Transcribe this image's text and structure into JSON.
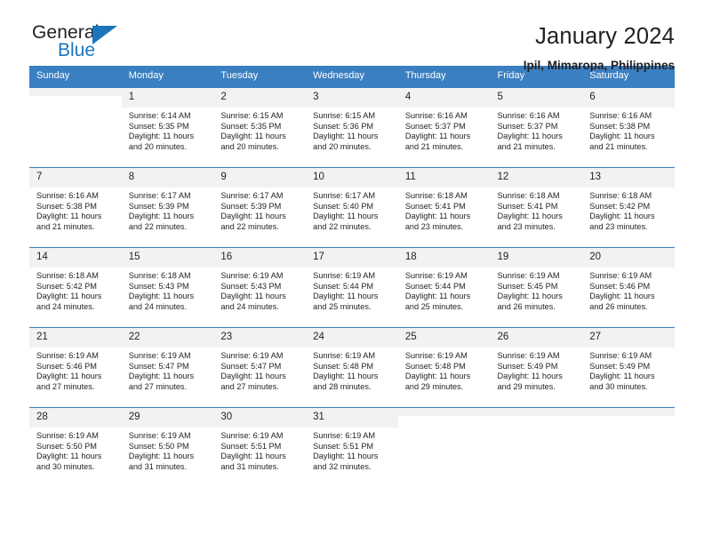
{
  "brand": {
    "name_part1": "General",
    "name_part2": "Blue",
    "triangle_color": "#1b75bb"
  },
  "header": {
    "title": "January 2024",
    "subtitle": "Ipil, Mimaropa, Philippines",
    "header_bg": "#3a7fc1"
  },
  "weekdays": [
    "Sunday",
    "Monday",
    "Tuesday",
    "Wednesday",
    "Thursday",
    "Friday",
    "Saturday"
  ],
  "weeks": [
    [
      {
        "day": "",
        "sunrise": "",
        "sunset": "",
        "daylight1": "",
        "daylight2": ""
      },
      {
        "day": "1",
        "sunrise": "Sunrise: 6:14 AM",
        "sunset": "Sunset: 5:35 PM",
        "daylight1": "Daylight: 11 hours",
        "daylight2": "and 20 minutes."
      },
      {
        "day": "2",
        "sunrise": "Sunrise: 6:15 AM",
        "sunset": "Sunset: 5:35 PM",
        "daylight1": "Daylight: 11 hours",
        "daylight2": "and 20 minutes."
      },
      {
        "day": "3",
        "sunrise": "Sunrise: 6:15 AM",
        "sunset": "Sunset: 5:36 PM",
        "daylight1": "Daylight: 11 hours",
        "daylight2": "and 20 minutes."
      },
      {
        "day": "4",
        "sunrise": "Sunrise: 6:16 AM",
        "sunset": "Sunset: 5:37 PM",
        "daylight1": "Daylight: 11 hours",
        "daylight2": "and 21 minutes."
      },
      {
        "day": "5",
        "sunrise": "Sunrise: 6:16 AM",
        "sunset": "Sunset: 5:37 PM",
        "daylight1": "Daylight: 11 hours",
        "daylight2": "and 21 minutes."
      },
      {
        "day": "6",
        "sunrise": "Sunrise: 6:16 AM",
        "sunset": "Sunset: 5:38 PM",
        "daylight1": "Daylight: 11 hours",
        "daylight2": "and 21 minutes."
      }
    ],
    [
      {
        "day": "7",
        "sunrise": "Sunrise: 6:16 AM",
        "sunset": "Sunset: 5:38 PM",
        "daylight1": "Daylight: 11 hours",
        "daylight2": "and 21 minutes."
      },
      {
        "day": "8",
        "sunrise": "Sunrise: 6:17 AM",
        "sunset": "Sunset: 5:39 PM",
        "daylight1": "Daylight: 11 hours",
        "daylight2": "and 22 minutes."
      },
      {
        "day": "9",
        "sunrise": "Sunrise: 6:17 AM",
        "sunset": "Sunset: 5:39 PM",
        "daylight1": "Daylight: 11 hours",
        "daylight2": "and 22 minutes."
      },
      {
        "day": "10",
        "sunrise": "Sunrise: 6:17 AM",
        "sunset": "Sunset: 5:40 PM",
        "daylight1": "Daylight: 11 hours",
        "daylight2": "and 22 minutes."
      },
      {
        "day": "11",
        "sunrise": "Sunrise: 6:18 AM",
        "sunset": "Sunset: 5:41 PM",
        "daylight1": "Daylight: 11 hours",
        "daylight2": "and 23 minutes."
      },
      {
        "day": "12",
        "sunrise": "Sunrise: 6:18 AM",
        "sunset": "Sunset: 5:41 PM",
        "daylight1": "Daylight: 11 hours",
        "daylight2": "and 23 minutes."
      },
      {
        "day": "13",
        "sunrise": "Sunrise: 6:18 AM",
        "sunset": "Sunset: 5:42 PM",
        "daylight1": "Daylight: 11 hours",
        "daylight2": "and 23 minutes."
      }
    ],
    [
      {
        "day": "14",
        "sunrise": "Sunrise: 6:18 AM",
        "sunset": "Sunset: 5:42 PM",
        "daylight1": "Daylight: 11 hours",
        "daylight2": "and 24 minutes."
      },
      {
        "day": "15",
        "sunrise": "Sunrise: 6:18 AM",
        "sunset": "Sunset: 5:43 PM",
        "daylight1": "Daylight: 11 hours",
        "daylight2": "and 24 minutes."
      },
      {
        "day": "16",
        "sunrise": "Sunrise: 6:19 AM",
        "sunset": "Sunset: 5:43 PM",
        "daylight1": "Daylight: 11 hours",
        "daylight2": "and 24 minutes."
      },
      {
        "day": "17",
        "sunrise": "Sunrise: 6:19 AM",
        "sunset": "Sunset: 5:44 PM",
        "daylight1": "Daylight: 11 hours",
        "daylight2": "and 25 minutes."
      },
      {
        "day": "18",
        "sunrise": "Sunrise: 6:19 AM",
        "sunset": "Sunset: 5:44 PM",
        "daylight1": "Daylight: 11 hours",
        "daylight2": "and 25 minutes."
      },
      {
        "day": "19",
        "sunrise": "Sunrise: 6:19 AM",
        "sunset": "Sunset: 5:45 PM",
        "daylight1": "Daylight: 11 hours",
        "daylight2": "and 26 minutes."
      },
      {
        "day": "20",
        "sunrise": "Sunrise: 6:19 AM",
        "sunset": "Sunset: 5:46 PM",
        "daylight1": "Daylight: 11 hours",
        "daylight2": "and 26 minutes."
      }
    ],
    [
      {
        "day": "21",
        "sunrise": "Sunrise: 6:19 AM",
        "sunset": "Sunset: 5:46 PM",
        "daylight1": "Daylight: 11 hours",
        "daylight2": "and 27 minutes."
      },
      {
        "day": "22",
        "sunrise": "Sunrise: 6:19 AM",
        "sunset": "Sunset: 5:47 PM",
        "daylight1": "Daylight: 11 hours",
        "daylight2": "and 27 minutes."
      },
      {
        "day": "23",
        "sunrise": "Sunrise: 6:19 AM",
        "sunset": "Sunset: 5:47 PM",
        "daylight1": "Daylight: 11 hours",
        "daylight2": "and 27 minutes."
      },
      {
        "day": "24",
        "sunrise": "Sunrise: 6:19 AM",
        "sunset": "Sunset: 5:48 PM",
        "daylight1": "Daylight: 11 hours",
        "daylight2": "and 28 minutes."
      },
      {
        "day": "25",
        "sunrise": "Sunrise: 6:19 AM",
        "sunset": "Sunset: 5:48 PM",
        "daylight1": "Daylight: 11 hours",
        "daylight2": "and 29 minutes."
      },
      {
        "day": "26",
        "sunrise": "Sunrise: 6:19 AM",
        "sunset": "Sunset: 5:49 PM",
        "daylight1": "Daylight: 11 hours",
        "daylight2": "and 29 minutes."
      },
      {
        "day": "27",
        "sunrise": "Sunrise: 6:19 AM",
        "sunset": "Sunset: 5:49 PM",
        "daylight1": "Daylight: 11 hours",
        "daylight2": "and 30 minutes."
      }
    ],
    [
      {
        "day": "28",
        "sunrise": "Sunrise: 6:19 AM",
        "sunset": "Sunset: 5:50 PM",
        "daylight1": "Daylight: 11 hours",
        "daylight2": "and 30 minutes."
      },
      {
        "day": "29",
        "sunrise": "Sunrise: 6:19 AM",
        "sunset": "Sunset: 5:50 PM",
        "daylight1": "Daylight: 11 hours",
        "daylight2": "and 31 minutes."
      },
      {
        "day": "30",
        "sunrise": "Sunrise: 6:19 AM",
        "sunset": "Sunset: 5:51 PM",
        "daylight1": "Daylight: 11 hours",
        "daylight2": "and 31 minutes."
      },
      {
        "day": "31",
        "sunrise": "Sunrise: 6:19 AM",
        "sunset": "Sunset: 5:51 PM",
        "daylight1": "Daylight: 11 hours",
        "daylight2": "and 32 minutes."
      },
      {
        "day": "",
        "sunrise": "",
        "sunset": "",
        "daylight1": "",
        "daylight2": ""
      },
      {
        "day": "",
        "sunrise": "",
        "sunset": "",
        "daylight1": "",
        "daylight2": ""
      },
      {
        "day": "",
        "sunrise": "",
        "sunset": "",
        "daylight1": "",
        "daylight2": ""
      }
    ]
  ]
}
